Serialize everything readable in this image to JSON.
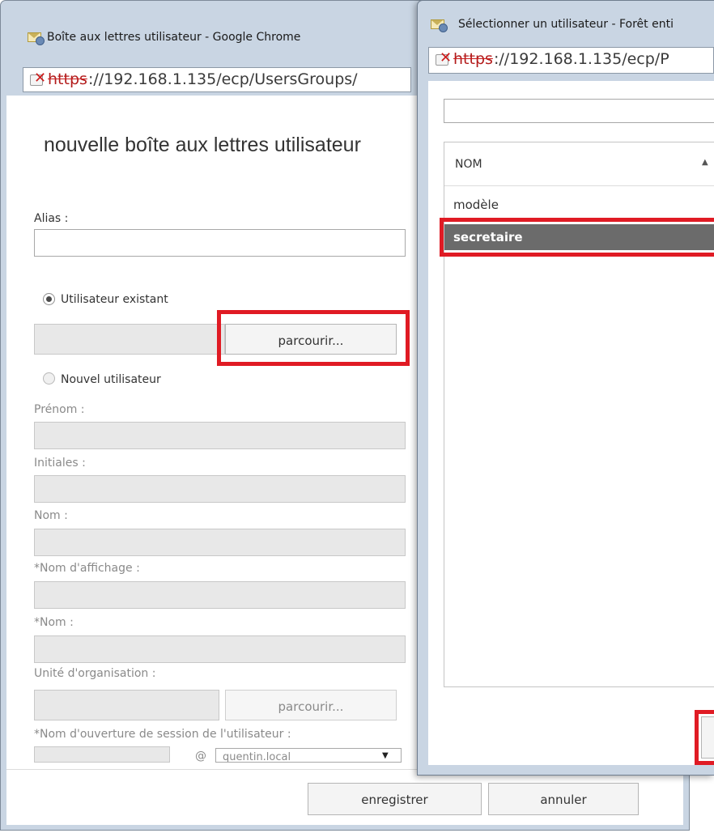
{
  "main_window": {
    "title": "Boîte aux lettres utilisateur - Google Chrome",
    "url_scheme": "https",
    "url_rest": "://192.168.1.135/ecp/UsersGroups/",
    "heading": "nouvelle boîte aux lettres utilisateur",
    "alias_label": "Alias :",
    "alias_value": "",
    "existing_user_label": "Utilisateur existant",
    "existing_user_selected": true,
    "browse_label": "parcourir...",
    "new_user_label": "Nouvel utilisateur",
    "first_name_label": "Prénom :",
    "initials_label": "Initiales :",
    "last_name_label": "Nom :",
    "display_name_label": "*Nom d'affichage :",
    "name_label": "*Nom :",
    "org_unit_label": "Unité d'organisation :",
    "org_browse_label": "parcourir...",
    "logon_name_label": "*Nom d'ouverture de session de l'utilisateur :",
    "at_sign": "@",
    "domain_value": "quentin.local",
    "save_label": "enregistrer",
    "cancel_label": "annuler"
  },
  "dialog_window": {
    "title": "Sélectionner un utilisateur - Forêt enti",
    "url_scheme": "https",
    "url_rest": "://192.168.1.135/ecp/P",
    "search_value": "",
    "column_header": "NOM",
    "sort_indicator": "▲",
    "rows": [
      {
        "name": "modèle",
        "selected": false
      },
      {
        "name": "secretaire",
        "selected": true
      }
    ]
  },
  "colors": {
    "highlight": "#e01b24",
    "selected_row": "#6b6b6b",
    "window_frame": "#c9d5e3"
  },
  "icons": {
    "app": "mailbox-icon",
    "security": "insecure-lock-icon",
    "sort": "sort-ascending-icon",
    "dropdown": "chevron-down-icon"
  }
}
